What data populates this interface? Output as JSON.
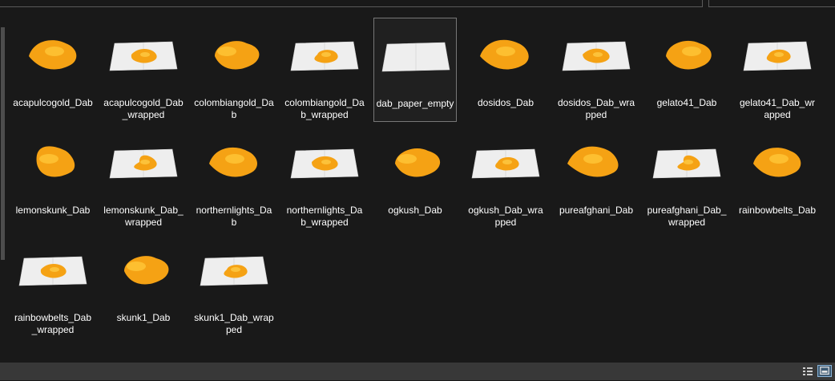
{
  "explorer": {
    "files": [
      {
        "name": "acapulcogold_Dab",
        "thumb": "dab"
      },
      {
        "name": "acapulcogold_Dab_wrapped",
        "thumb": "paper-dab"
      },
      {
        "name": "colombiangold_Dab",
        "thumb": "dab"
      },
      {
        "name": "colombiangold_Dab_wrapped",
        "thumb": "paper-dab"
      },
      {
        "name": "dab_paper_empty",
        "thumb": "paper",
        "selected": true
      },
      {
        "name": "dosidos_Dab",
        "thumb": "dab"
      },
      {
        "name": "dosidos_Dab_wrapped",
        "thumb": "paper-dab"
      },
      {
        "name": "gelato41_Dab",
        "thumb": "dab"
      },
      {
        "name": "gelato41_Dab_wrapped",
        "thumb": "paper-dab"
      },
      {
        "name": "lemonskunk_Dab",
        "thumb": "dab"
      },
      {
        "name": "lemonskunk_Dab_wrapped",
        "thumb": "paper-dab"
      },
      {
        "name": "northernlights_Dab",
        "thumb": "dab"
      },
      {
        "name": "northernlights_Dab_wrapped",
        "thumb": "paper-dab"
      },
      {
        "name": "ogkush_Dab",
        "thumb": "dab"
      },
      {
        "name": "ogkush_Dab_wrapped",
        "thumb": "paper-dab"
      },
      {
        "name": "pureafghani_Dab",
        "thumb": "dab"
      },
      {
        "name": "pureafghani_Dab_wrapped",
        "thumb": "paper-dab"
      },
      {
        "name": "rainbowbelts_Dab",
        "thumb": "dab"
      },
      {
        "name": "rainbowbelts_Dab_wrapped",
        "thumb": "paper-dab"
      },
      {
        "name": "skunk1_Dab",
        "thumb": "dab"
      },
      {
        "name": "skunk1_Dab_wrapped",
        "thumb": "paper-dab"
      }
    ]
  },
  "statusbar": {
    "details_view_icon": "details-view-icon",
    "large_icons_view_icon": "large-icons-view-icon"
  },
  "colors": {
    "background": "#191919",
    "statusbar": "#383838",
    "selection_border": "#777777",
    "concentrate": "#f5a214",
    "paper": "#eeeeee"
  }
}
